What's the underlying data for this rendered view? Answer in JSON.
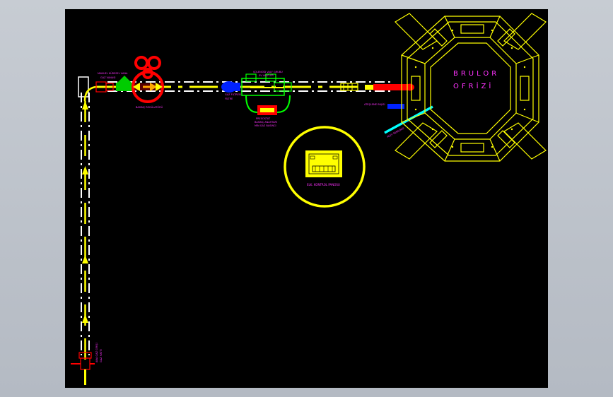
{
  "drawing": {
    "furnace_title_line1": "BRULOR",
    "furnace_title_line2": "OFRİZİ",
    "control_box_label": "ELK. KONTROL PANOSU",
    "labels": {
      "valve_top": "MANUEL KÜRESEL VANA",
      "valve_top_sub": "GAZ VANASI",
      "regulator": "BASINÇ REGÜLATÖRÜ",
      "filter": "GAZ FİLTRESİ",
      "filter_sub": "FİLTRE",
      "solenoid_group": "SOLENOİD VALF GRUBU",
      "solenoid_group_sub": "SV VALFLER",
      "pressure_switch": "PRESOSTAT",
      "pressure_switch_sub": "BASINÇ ANAHTARI",
      "pressure_switch_sub2": "MİN GAZ BASINCI",
      "burner_nozzle": "ATEŞLEME BUJİSİ",
      "flame_sensor": "ALEV SENSÖRÜ",
      "inlet_valve": "ANA GAZ GİRİŞİ",
      "inlet_valve_sub": "GAZ HATTI"
    }
  },
  "colors": {
    "background": "#000000",
    "pipe": "#ffffff",
    "flow_arrow": "#ffff00",
    "furnace": "#ffff00",
    "label": "#ff33ff",
    "burner": "#ff0000",
    "regulator": "#ff0000",
    "blue_component": "#0022ff",
    "green_component": "#00ff00",
    "sensor_line": "#00ffff"
  }
}
